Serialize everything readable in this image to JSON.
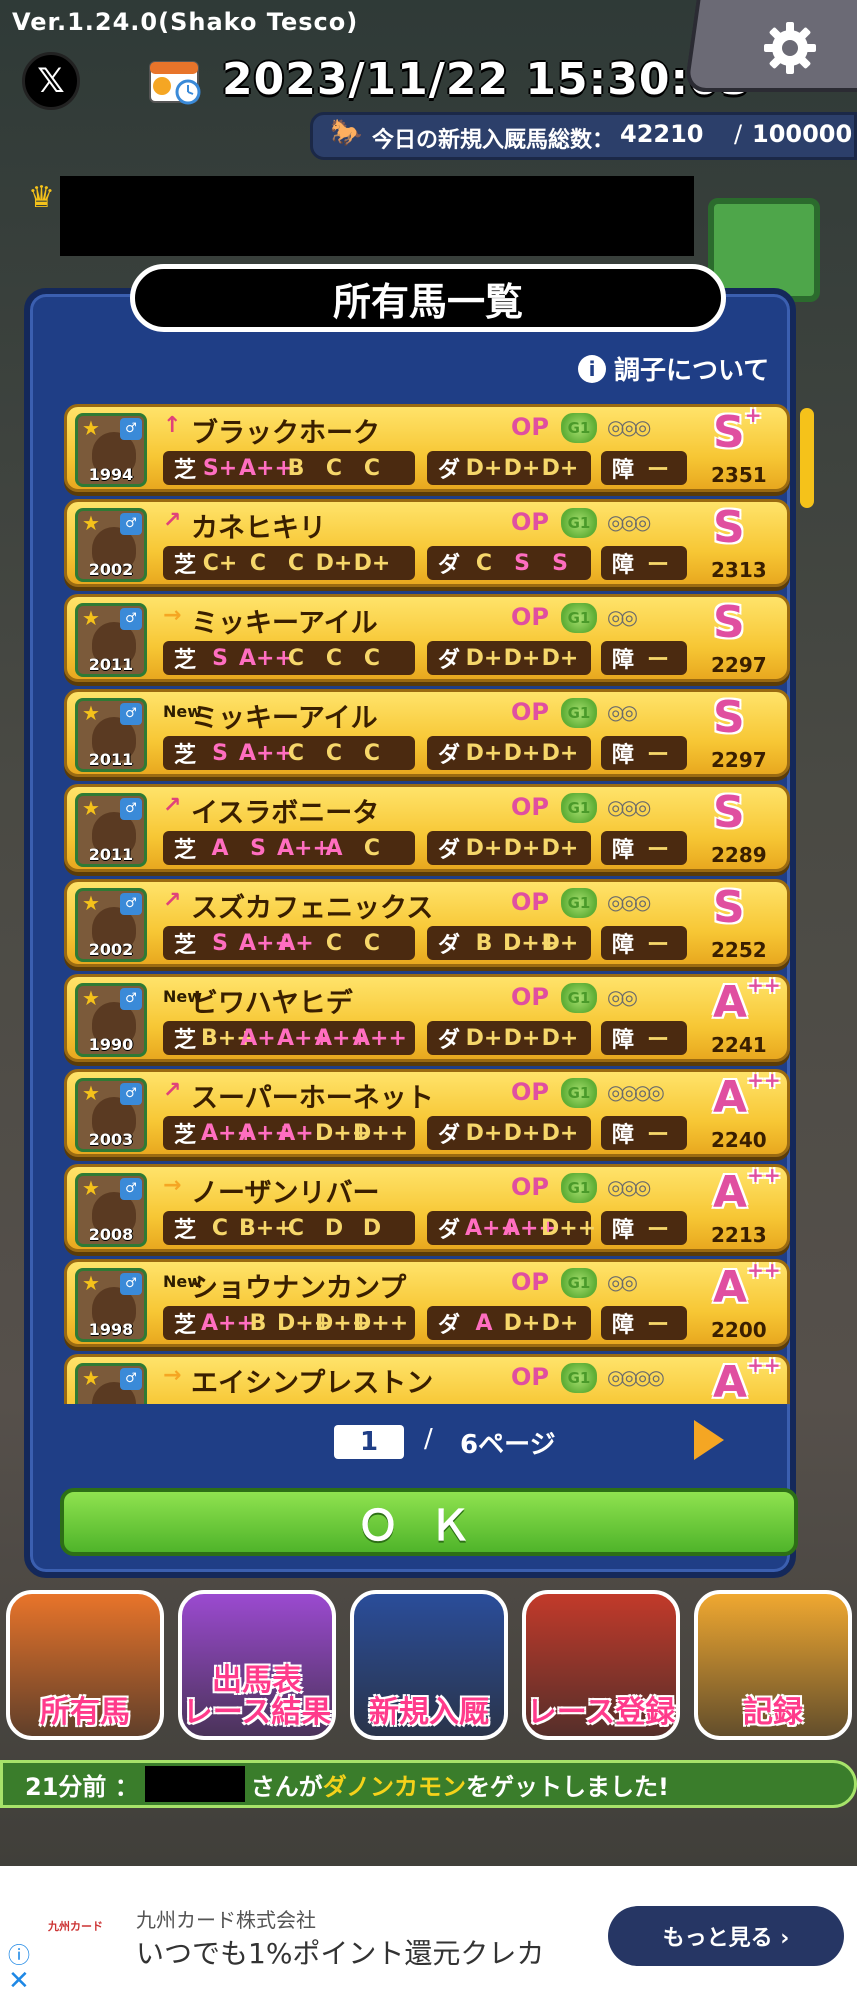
{
  "app": {
    "version": "Ver.1.24.0(Shako Tesco)",
    "datetime": "2023/11/22 15:30:03"
  },
  "entry": {
    "label": "今日の新規入厩馬総数：",
    "count": "42210",
    "slash": "/",
    "max": "100000"
  },
  "modal": {
    "title": "所有馬一覧",
    "condition_link": "調子について"
  },
  "labels": {
    "turf": "芝",
    "dirt": "ダ",
    "hurdle": "障",
    "op": "OP",
    "g1": "G1"
  },
  "horses": [
    {
      "name": "ブラックホーク",
      "year": "1994",
      "arrow": "↑",
      "arrow_color": "#e0427a",
      "grade": "S",
      "sup": "+",
      "score": "2351",
      "turf": [
        "S+",
        "A++",
        "B",
        "C",
        "C"
      ],
      "dirt": [
        "D+",
        "D+",
        "D+"
      ],
      "hurdle": "ー",
      "shoes": "◎◎◎"
    },
    {
      "name": "カネヒキリ",
      "year": "2002",
      "arrow": "↗",
      "arrow_color": "#e0427a",
      "grade": "S",
      "sup": "",
      "score": "2313",
      "turf": [
        "C+",
        "C",
        "C",
        "D+",
        "D+"
      ],
      "dirt": [
        "C",
        "S",
        "S"
      ],
      "hurdle": "ー",
      "shoes": "◎◎◎"
    },
    {
      "name": "ミッキーアイル",
      "year": "2011",
      "arrow": "→",
      "arrow_color": "#f5a623",
      "grade": "S",
      "sup": "",
      "score": "2297",
      "turf": [
        "S",
        "A++",
        "C",
        "C",
        "C"
      ],
      "dirt": [
        "D+",
        "D+",
        "D+"
      ],
      "hurdle": "ー",
      "shoes": "◎◎"
    },
    {
      "name": "ミッキーアイル",
      "year": "2011",
      "arrow": "New",
      "arrow_color": "#2d1d00",
      "grade": "S",
      "sup": "",
      "score": "2297",
      "turf": [
        "S",
        "A++",
        "C",
        "C",
        "C"
      ],
      "dirt": [
        "D+",
        "D+",
        "D+"
      ],
      "hurdle": "ー",
      "shoes": "◎◎"
    },
    {
      "name": "イスラボニータ",
      "year": "2011",
      "arrow": "↗",
      "arrow_color": "#e0427a",
      "grade": "S",
      "sup": "",
      "score": "2289",
      "turf": [
        "A",
        "S",
        "A++",
        "A",
        "C"
      ],
      "dirt": [
        "D+",
        "D+",
        "D+"
      ],
      "hurdle": "ー",
      "shoes": "◎◎◎"
    },
    {
      "name": "スズカフェニックス",
      "year": "2002",
      "arrow": "↗",
      "arrow_color": "#e0427a",
      "grade": "S",
      "sup": "",
      "score": "2252",
      "turf": [
        "S",
        "A++",
        "A+",
        "C",
        "C"
      ],
      "dirt": [
        "B",
        "D++",
        "D+"
      ],
      "hurdle": "ー",
      "shoes": "◎◎◎"
    },
    {
      "name": "ビワハヤヒデ",
      "year": "1990",
      "arrow": "New",
      "arrow_color": "#2d1d00",
      "grade": "A",
      "sup": "++",
      "score": "2241",
      "turf": [
        "B++",
        "A+",
        "A++",
        "A++",
        "A++"
      ],
      "dirt": [
        "D+",
        "D+",
        "D+"
      ],
      "hurdle": "ー",
      "shoes": "◎◎"
    },
    {
      "name": "スーパーホーネット",
      "year": "2003",
      "arrow": "↗",
      "arrow_color": "#e0427a",
      "grade": "A",
      "sup": "++",
      "score": "2240",
      "turf": [
        "A++",
        "A++",
        "A+",
        "D++",
        "D++"
      ],
      "dirt": [
        "D+",
        "D+",
        "D+"
      ],
      "hurdle": "ー",
      "shoes": "◎◎◎◎"
    },
    {
      "name": "ノーザンリバー",
      "year": "2008",
      "arrow": "→",
      "arrow_color": "#f5a623",
      "grade": "A",
      "sup": "++",
      "score": "2213",
      "turf": [
        "C",
        "B++",
        "C",
        "D",
        "D"
      ],
      "dirt": [
        "A++",
        "A++",
        "D++"
      ],
      "hurdle": "ー",
      "shoes": "◎◎◎"
    },
    {
      "name": "ショウナンカンプ",
      "year": "1998",
      "arrow": "New",
      "arrow_color": "#2d1d00",
      "grade": "A",
      "sup": "++",
      "score": "2200",
      "turf": [
        "A++",
        "B",
        "D++",
        "D++",
        "D++"
      ],
      "dirt": [
        "A",
        "D+",
        "D+"
      ],
      "hurdle": "ー",
      "shoes": "◎◎"
    },
    {
      "name": "エイシンプレストン",
      "year": "",
      "arrow": "→",
      "arrow_color": "#f5a623",
      "grade": "A",
      "sup": "++",
      "score": "",
      "turf": [],
      "dirt": [],
      "hurdle": "",
      "shoes": "◎◎◎◎"
    }
  ],
  "pager": {
    "current": "1",
    "slash": "/",
    "total": "6ページ"
  },
  "ok_label": "ＯＫ",
  "nav": [
    {
      "label": "所有馬",
      "color": "#e8742a"
    },
    {
      "label": "出馬表\nレース結果",
      "color": "#9b4ad0"
    },
    {
      "label": "新規入厩",
      "color": "#2a4d9a"
    },
    {
      "label": "レース登録",
      "color": "#c23a2a"
    },
    {
      "label": "記録",
      "color": "#f0a830"
    }
  ],
  "ticker": {
    "time": "21分前 ：",
    "pre": "さんが",
    "horse": "ダノンカモン",
    "post": "をゲットしました!"
  },
  "ad": {
    "logo": "九州カード",
    "company": "九州カード株式会社",
    "text": "いつでも1%ポイント還元クレカ",
    "button": "もっと見る ›",
    "close": "✕",
    "info": "ⓘ"
  }
}
